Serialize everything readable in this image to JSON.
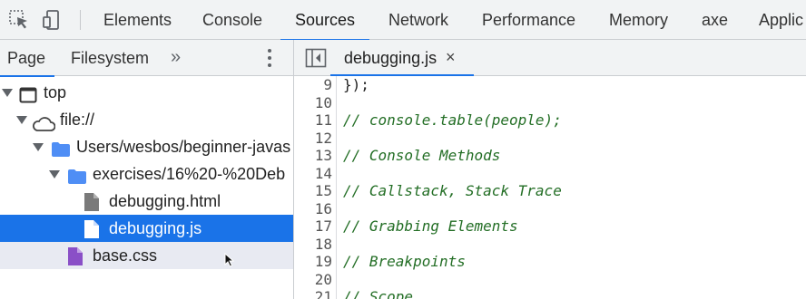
{
  "toolbar": {
    "tabs": [
      "Elements",
      "Console",
      "Sources",
      "Network",
      "Performance",
      "Memory",
      "axe",
      "Applic"
    ],
    "active_tab": "Sources",
    "icons": [
      "inspect-element-icon",
      "device-toolbar-icon"
    ]
  },
  "navigator": {
    "tabs": [
      "Page",
      "Filesystem"
    ],
    "active_tab": "Page",
    "more": "»",
    "tree": [
      {
        "label": "top",
        "icon": "frame-icon",
        "expanded": true
      },
      {
        "label": "file://",
        "icon": "cloud-icon",
        "expanded": true
      },
      {
        "label": "Users/wesbos/beginner-javas",
        "icon": "folder-icon",
        "expanded": true
      },
      {
        "label": "exercises/16%20-%20Deb",
        "icon": "folder-icon",
        "expanded": true
      },
      {
        "label": "debugging.html",
        "icon": "file-icon"
      },
      {
        "label": "debugging.js",
        "icon": "file-icon",
        "selected": true
      },
      {
        "label": "base.css",
        "icon": "css-file-icon"
      }
    ]
  },
  "editor": {
    "open_file": "debugging.js",
    "close_label": "×",
    "lines": [
      {
        "n": "9",
        "text": "});",
        "comment": false
      },
      {
        "n": "10",
        "text": "",
        "comment": false
      },
      {
        "n": "11",
        "text": "// console.table(people);",
        "comment": true
      },
      {
        "n": "12",
        "text": "",
        "comment": false
      },
      {
        "n": "13",
        "text": "// Console Methods",
        "comment": true
      },
      {
        "n": "14",
        "text": "",
        "comment": false
      },
      {
        "n": "15",
        "text": "// Callstack, Stack Trace",
        "comment": true
      },
      {
        "n": "16",
        "text": "",
        "comment": false
      },
      {
        "n": "17",
        "text": "// Grabbing Elements",
        "comment": true
      },
      {
        "n": "18",
        "text": "",
        "comment": false
      },
      {
        "n": "19",
        "text": "// Breakpoints",
        "comment": true
      },
      {
        "n": "20",
        "text": "",
        "comment": false
      },
      {
        "n": "21",
        "text": "// Scope",
        "comment": true
      }
    ]
  },
  "colors": {
    "accent": "#1a73e8",
    "folder": "#4f8ef5",
    "css_file": "#8a4fc7",
    "comment": "#236e25"
  }
}
